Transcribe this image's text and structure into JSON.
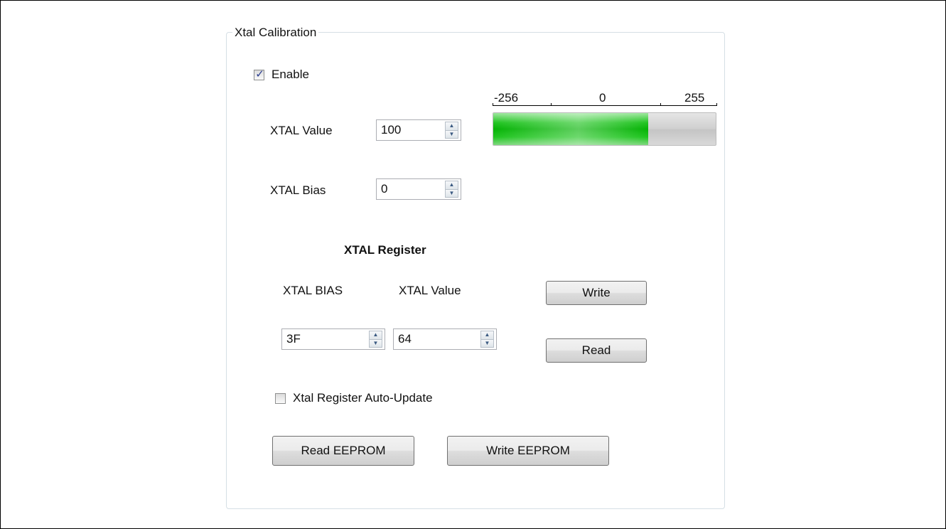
{
  "group": {
    "title": "Xtal Calibration"
  },
  "enable": {
    "label": "Enable",
    "checked": true
  },
  "xtal_value": {
    "label": "XTAL Value",
    "value": "100"
  },
  "xtal_bias": {
    "label": "XTAL Bias",
    "value": "0"
  },
  "scale": {
    "min_label": "-256",
    "mid_label": "0",
    "max_label": "255"
  },
  "progress": {
    "min": -256,
    "max": 255,
    "value": 100,
    "fill_color": "#06b306"
  },
  "register": {
    "heading": "XTAL Register",
    "bias_label": "XTAL BIAS",
    "value_label": "XTAL Value",
    "bias_value": "3F",
    "value_value": "64",
    "write_label": "Write",
    "read_label": "Read"
  },
  "auto_update": {
    "label": "Xtal Register Auto-Update",
    "checked": false
  },
  "eeprom": {
    "read_label": "Read EEPROM",
    "write_label": "Write EEPROM"
  }
}
